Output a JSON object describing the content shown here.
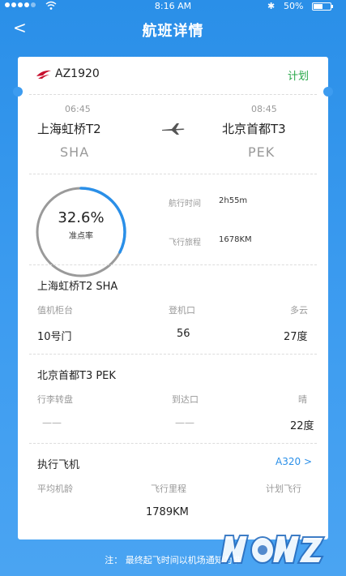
{
  "status_bar": {
    "time": "8:16 AM",
    "battery": "50%",
    "battery_level": 0.5
  },
  "nav": {
    "title": "航班详情",
    "back_symbol": "<"
  },
  "flight": {
    "number": "AZ1920",
    "status": "计划",
    "status_color": "#2aa84a"
  },
  "departure": {
    "time": "06:45",
    "city": "上海虹桥T2",
    "code": "SHA"
  },
  "arrival": {
    "time": "08:45",
    "city": "北京首都T3",
    "code": "PEK"
  },
  "on_time": {
    "rate": "32.6%",
    "rate_fraction": 0.326,
    "label": "准点率"
  },
  "stats": {
    "duration_label": "航行时间",
    "duration": "2h55m",
    "distance_label": "飞行旅程",
    "distance": "1678KM"
  },
  "dep_airport": {
    "title": "上海虹桥T2 SHA",
    "counter_label": "值机柜台",
    "counter": "10号门",
    "gate_label": "登机口",
    "gate": "56",
    "weather_label": "多云",
    "temperature": "27度"
  },
  "arr_airport": {
    "title": "北京首都T3 PEK",
    "baggage_label": "行李转盘",
    "baggage": "——",
    "exit_label": "到达口",
    "exit": "——",
    "weather_label": "晴",
    "temperature": "22度"
  },
  "aircraft": {
    "title": "执行飞机",
    "type_link": "A320 >",
    "age_label": "平均机龄",
    "mileage_label": "飞行里程",
    "mileage": "1789KM",
    "planned_label": "计划飞行"
  },
  "footer": {
    "note": "注： 最终起飞时间以机场通知为准"
  },
  "colors": {
    "accent": "#2a8fe8",
    "background_top": "#2a8fe8",
    "ring_progress": "#2a8fe8",
    "ring_track": "#9a9a9a",
    "airline_logo": "#c8102e"
  },
  "icons": {
    "back": "chevron-left-icon",
    "airline": "airline-logo-icon",
    "plane": "airplane-icon",
    "wifi": "wifi-icon",
    "bluetooth": "bluetooth-icon",
    "battery": "battery-icon"
  }
}
